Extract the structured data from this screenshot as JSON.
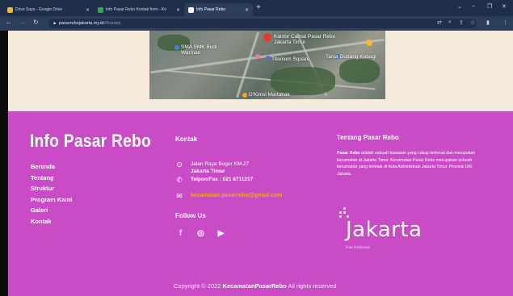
{
  "browser": {
    "tabs": [
      {
        "title": "Drive Saya - Google Drive",
        "active": false
      },
      {
        "title": "Info Pasar Rebo Kontak form - Ko",
        "active": false
      },
      {
        "title": "Info Pasar Rebo",
        "active": true
      }
    ],
    "new_tab_symbol": "+",
    "url_host": "pasarrebojakarta.my.id",
    "url_path": "/#kontak"
  },
  "map": {
    "labels": {
      "kantor": "Kantor Camat Pasar Rebo Jakarta Timur",
      "sman": "SMA SMK Budi Warman",
      "titanium": "Titanium Square",
      "tania": "Tania Gudang Kebagi",
      "d_kimsi": "D'Kimsi Martabak"
    }
  },
  "footer": {
    "brand": "Info Pasar Rebo",
    "menu": [
      "Beranda",
      "Tentang",
      "Struktur",
      "Program Kami",
      "Galeri",
      "Kontak"
    ],
    "kontak": {
      "title": "Kontak",
      "address_line1": "Jalan Raya Bogor KM.27",
      "address_line2": "Jakarta Timur",
      "phone": "Telpon/Fax : 021 8711217",
      "email": "kecamatan.pasarrebo@gmail.com",
      "follow_title": "Follow Us"
    },
    "tentang": {
      "title": "Tentang Pasar Rebo",
      "bold_lead": "Pasar Rebo",
      "body_1": " adalah sebuah kawasan yang cukup terkenal dan merupakan kecamatan di Jakarta Timur. Kecamatan Pasar Rebo merupakan sebuah kecamatan yang terletak di Kota Administrasi Jakarta Timur, Provinsi DKI Jakarta."
    },
    "logo": {
      "word": "Jakarta",
      "tagline": "kota kolaborasi"
    },
    "copyright": {
      "prefix": "Copyright © 2022 ",
      "owner": "KecamatanPasarRebo",
      "suffix": " All rights reserved"
    }
  },
  "colors": {
    "footer_bg": "#c94bc6",
    "page_bg": "#f7eadb",
    "email": "#f5a623"
  }
}
